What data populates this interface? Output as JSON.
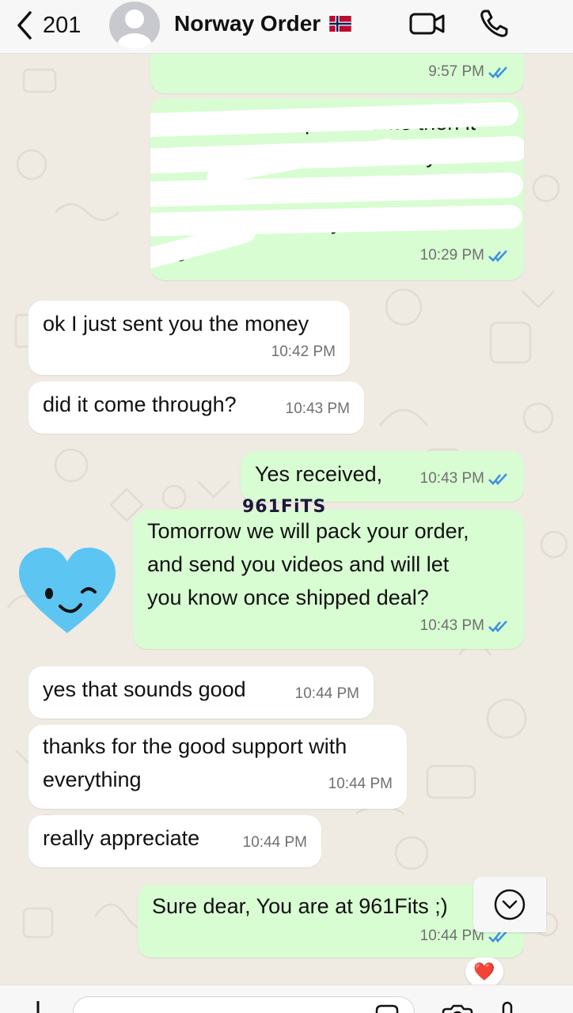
{
  "header": {
    "back_count": "201",
    "title": "Norway Order",
    "flag_icon": "norway-flag-icon",
    "video_icon": "video-call-icon",
    "call_icon": "phone-call-icon"
  },
  "watermark": "961FiTS",
  "messages": [
    {
      "dir": "out",
      "text": "",
      "time": "9:57 PM",
      "read": true
    },
    {
      "dir": "out",
      "text_lines": [
        "the link have a specific time then it",
        "will be expired dear so when you",
        "come to send the money if it was",
        "expired we resend you a new",
        "one"
      ],
      "time": "10:29 PM",
      "read": true,
      "redacted": true
    },
    {
      "dir": "in",
      "text": "ok I just sent you the money",
      "time": "10:42 PM"
    },
    {
      "dir": "in",
      "text": "did it come through?",
      "time": "10:43 PM"
    },
    {
      "dir": "out",
      "text": "Yes received,",
      "time": "10:43 PM",
      "read": true
    },
    {
      "dir": "out",
      "text_lines": [
        "Tomorrow we will pack your order,",
        "and send you videos and will let",
        "you know once shipped deal?"
      ],
      "time": "10:43 PM",
      "read": true
    },
    {
      "dir": "in",
      "text": "yes that sounds good",
      "time": "10:44 PM"
    },
    {
      "dir": "in",
      "text_lines": [
        "thanks for the good support with",
        "everything"
      ],
      "time": "10:44 PM"
    },
    {
      "dir": "in",
      "text": "really appreciate",
      "time": "10:44 PM"
    },
    {
      "dir": "out",
      "text": "Sure dear, You are at 961Fits ;)",
      "time": "10:44 PM",
      "read": true,
      "reaction": "❤️"
    }
  ],
  "colors": {
    "outgoing_bubble": "#d8fdd2",
    "incoming_bubble": "#ffffff",
    "chat_background": "#efeae2",
    "read_ticks": "#3b8ee5",
    "sticker_heart": "#5cc5f2"
  }
}
